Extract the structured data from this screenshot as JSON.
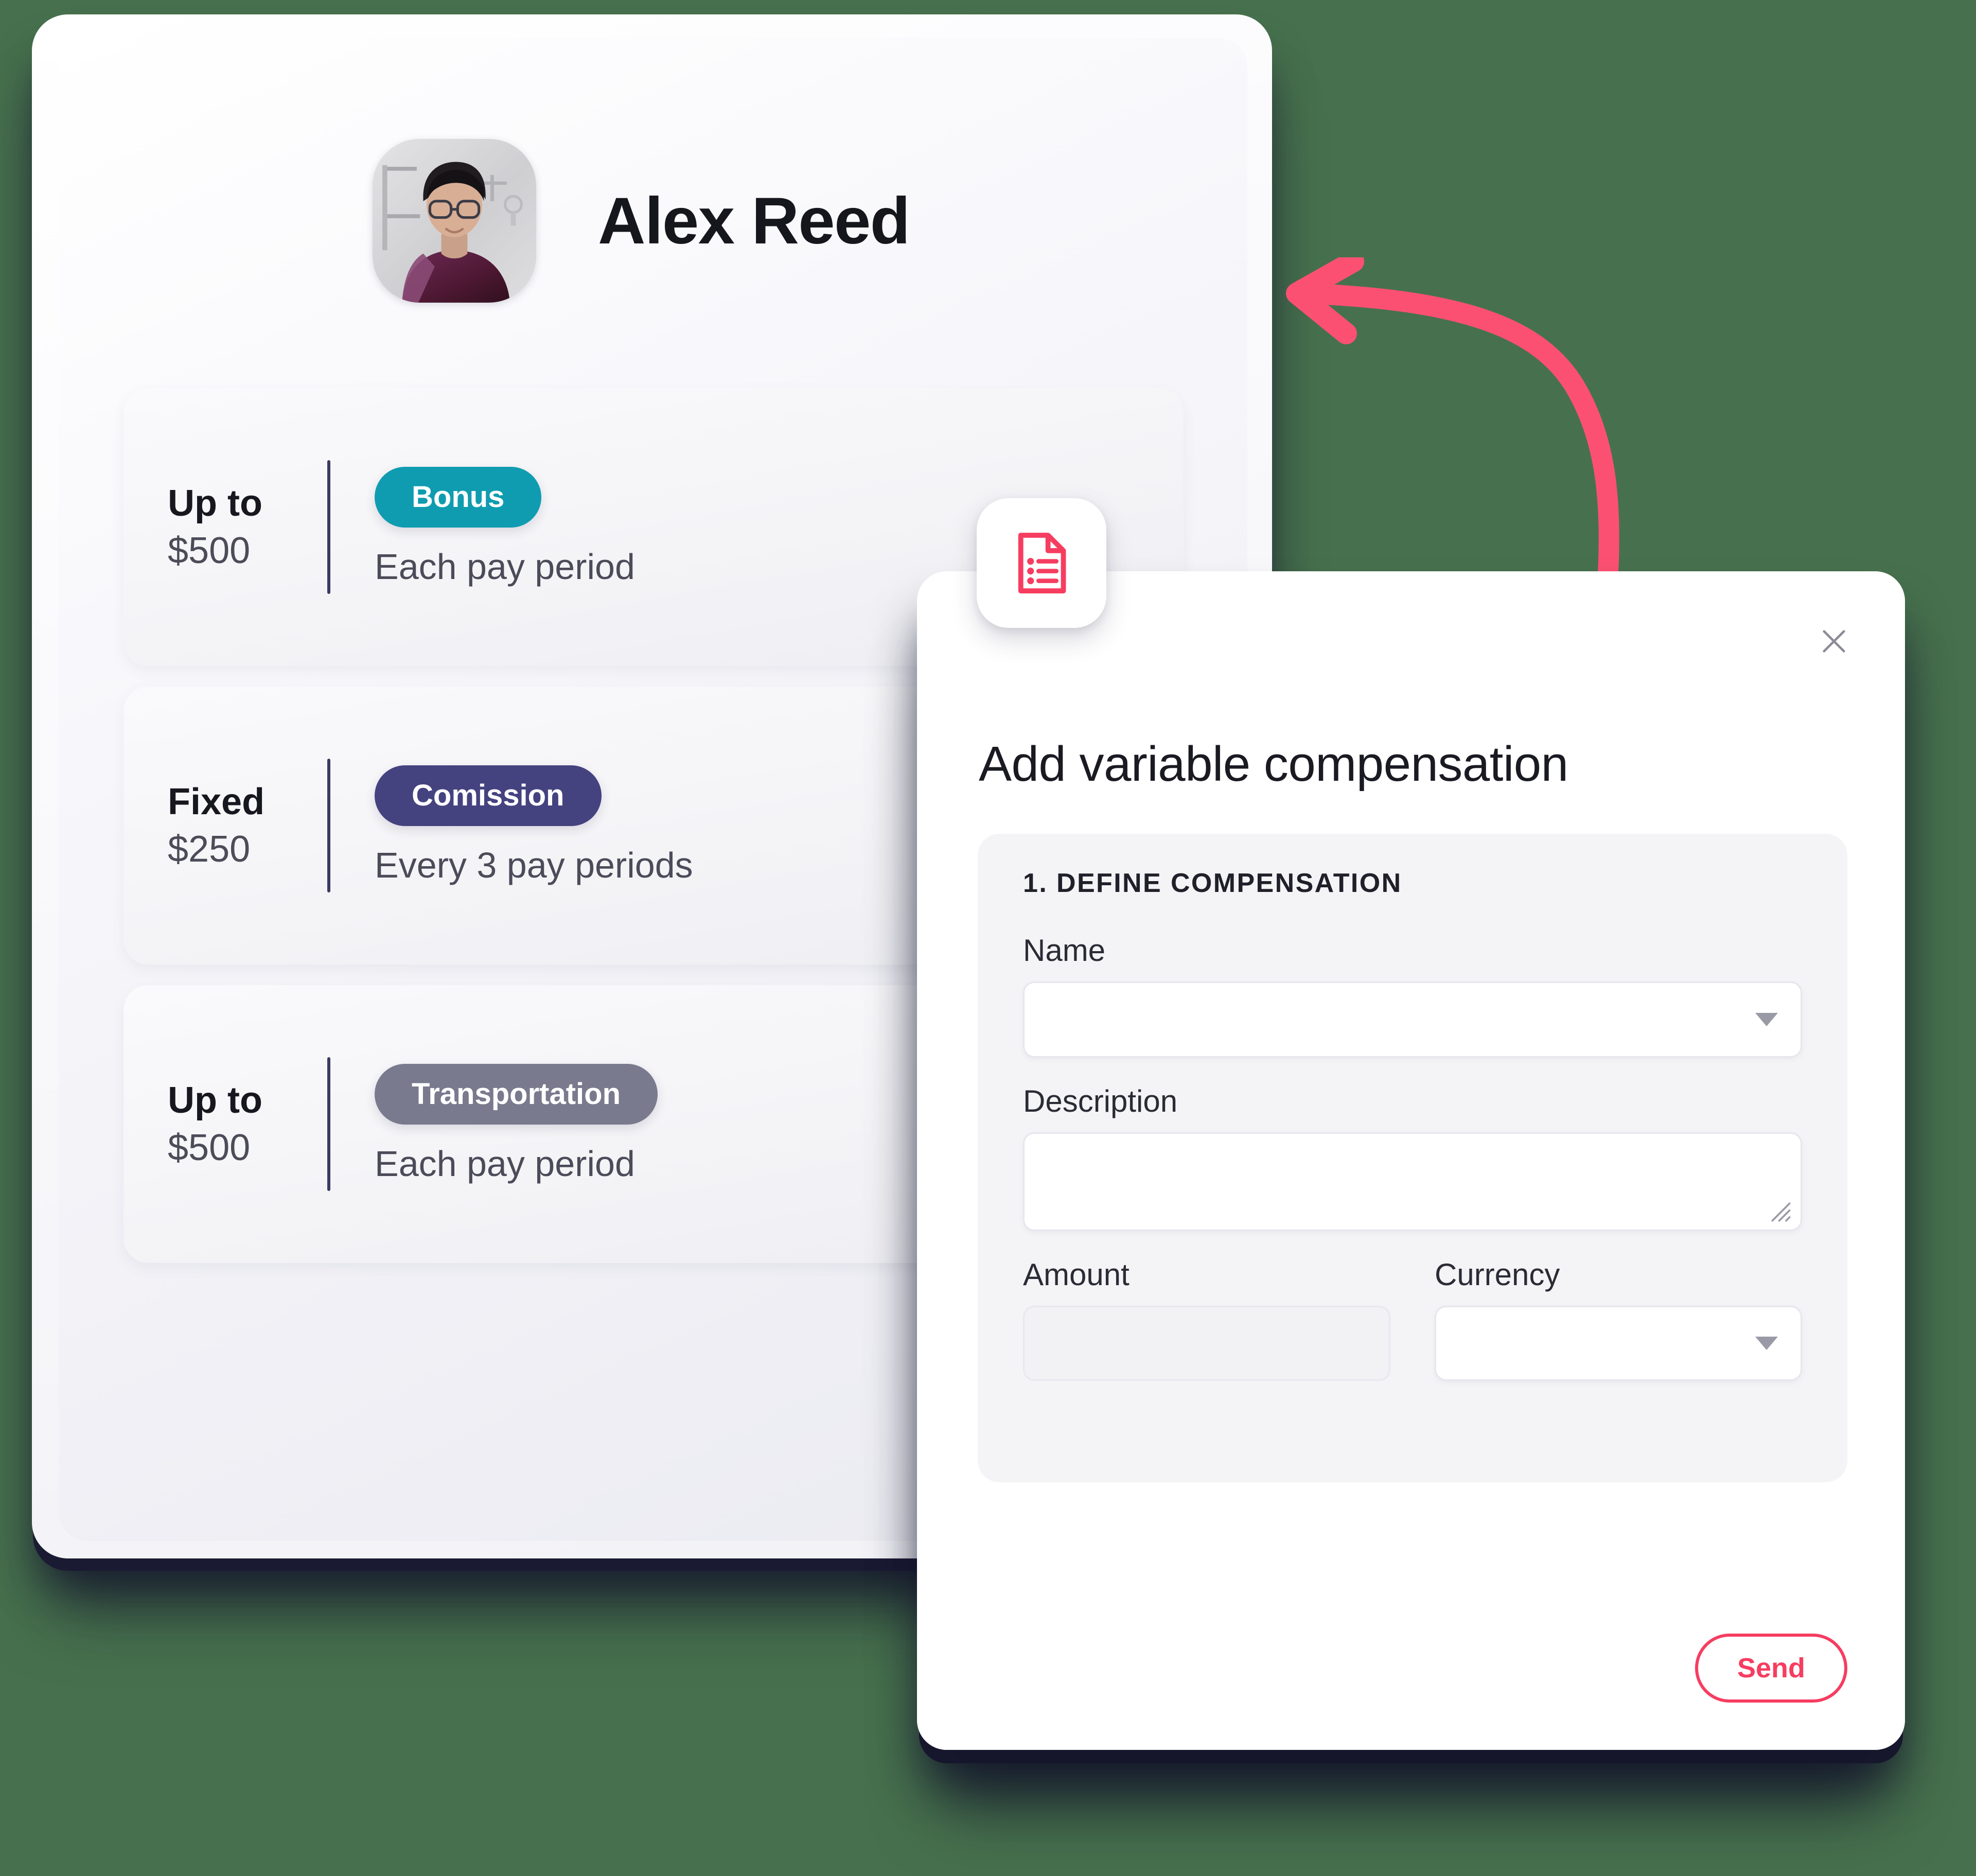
{
  "theme": {
    "background": "#47714e",
    "accent_pink": "#f63d60",
    "teal": "#109cb0",
    "navy": "#454280",
    "gray_purple": "#7a7a8e",
    "divider": "#3a3a62"
  },
  "profile_card": {
    "name": "Alex Reed",
    "avatar_alt": "Alex Reed profile photo",
    "compensations": [
      {
        "kind": "Up to",
        "amount": "$500",
        "pill_label": "Bonus",
        "pill_color": "#109cb0",
        "period": "Each pay period"
      },
      {
        "kind": "Fixed",
        "amount": "$250",
        "pill_label": "Comission",
        "pill_color": "#454280",
        "period": "Every 3 pay periods"
      },
      {
        "kind": "Up to",
        "amount": "$500",
        "pill_label": "Transportation",
        "pill_color": "#7a7a8e",
        "period": "Each pay period"
      }
    ]
  },
  "modal": {
    "title": "Add variable compensation",
    "close_icon": "close-icon",
    "badge_icon": "document-list-icon",
    "section_label": "1. DEFINE COMPENSATION",
    "fields": {
      "name": {
        "label": "Name",
        "value": "",
        "placeholder": "",
        "type": "select",
        "caret_icon": "chevron-down-icon"
      },
      "description": {
        "label": "Description",
        "value": "",
        "placeholder": "",
        "type": "textarea",
        "resize_icon": "resize-grip-icon"
      },
      "amount": {
        "label": "Amount",
        "value": "",
        "placeholder": "",
        "type": "text",
        "disabled": true
      },
      "currency": {
        "label": "Currency",
        "value": "",
        "placeholder": "",
        "type": "select",
        "caret_icon": "chevron-down-icon"
      }
    },
    "footer": {
      "send_label": "Send"
    }
  },
  "annotation": {
    "arrow_icon": "curved-arrow-left-icon",
    "arrow_color": "#fb5072"
  }
}
